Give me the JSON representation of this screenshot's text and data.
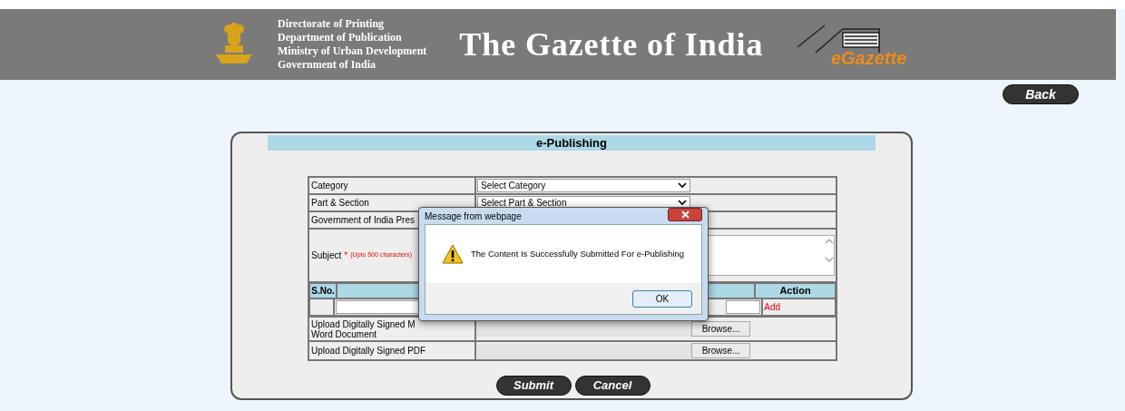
{
  "header": {
    "org_lines": [
      "Directorate of Printing",
      "Department of Publication",
      "Ministry of Urban Development",
      "Government of India"
    ],
    "title": "The Gazette of India",
    "logo_text": "eGazette"
  },
  "back_button": "Back",
  "panel": {
    "title": "e-Publishing",
    "rows": [
      {
        "kind": "select",
        "label": "Category",
        "value": "Select Category"
      },
      {
        "kind": "select",
        "label": "Part & Section",
        "value": "Select Part & Section"
      },
      {
        "kind": "text",
        "label": "Government of India Pres"
      },
      {
        "kind": "textarea",
        "label": "Subject",
        "required": "*",
        "hint": "(Upto 500 characters)"
      }
    ],
    "attachments": {
      "columns": [
        "S.No.",
        "",
        "Action"
      ],
      "action_link": "Add"
    },
    "uploads": [
      {
        "label_lines": [
          "Upload Digitally Signed M",
          "Word Document"
        ],
        "button": "Browse..."
      },
      {
        "label_lines": [
          "Upload Digitally Signed PDF"
        ],
        "button": "Browse..."
      }
    ],
    "buttons": [
      "Submit",
      "Cancel"
    ]
  },
  "dialog": {
    "title": "Message from webpage",
    "message": "The Content Is Successfully Submitted For e-Publishing",
    "button": "OK"
  }
}
